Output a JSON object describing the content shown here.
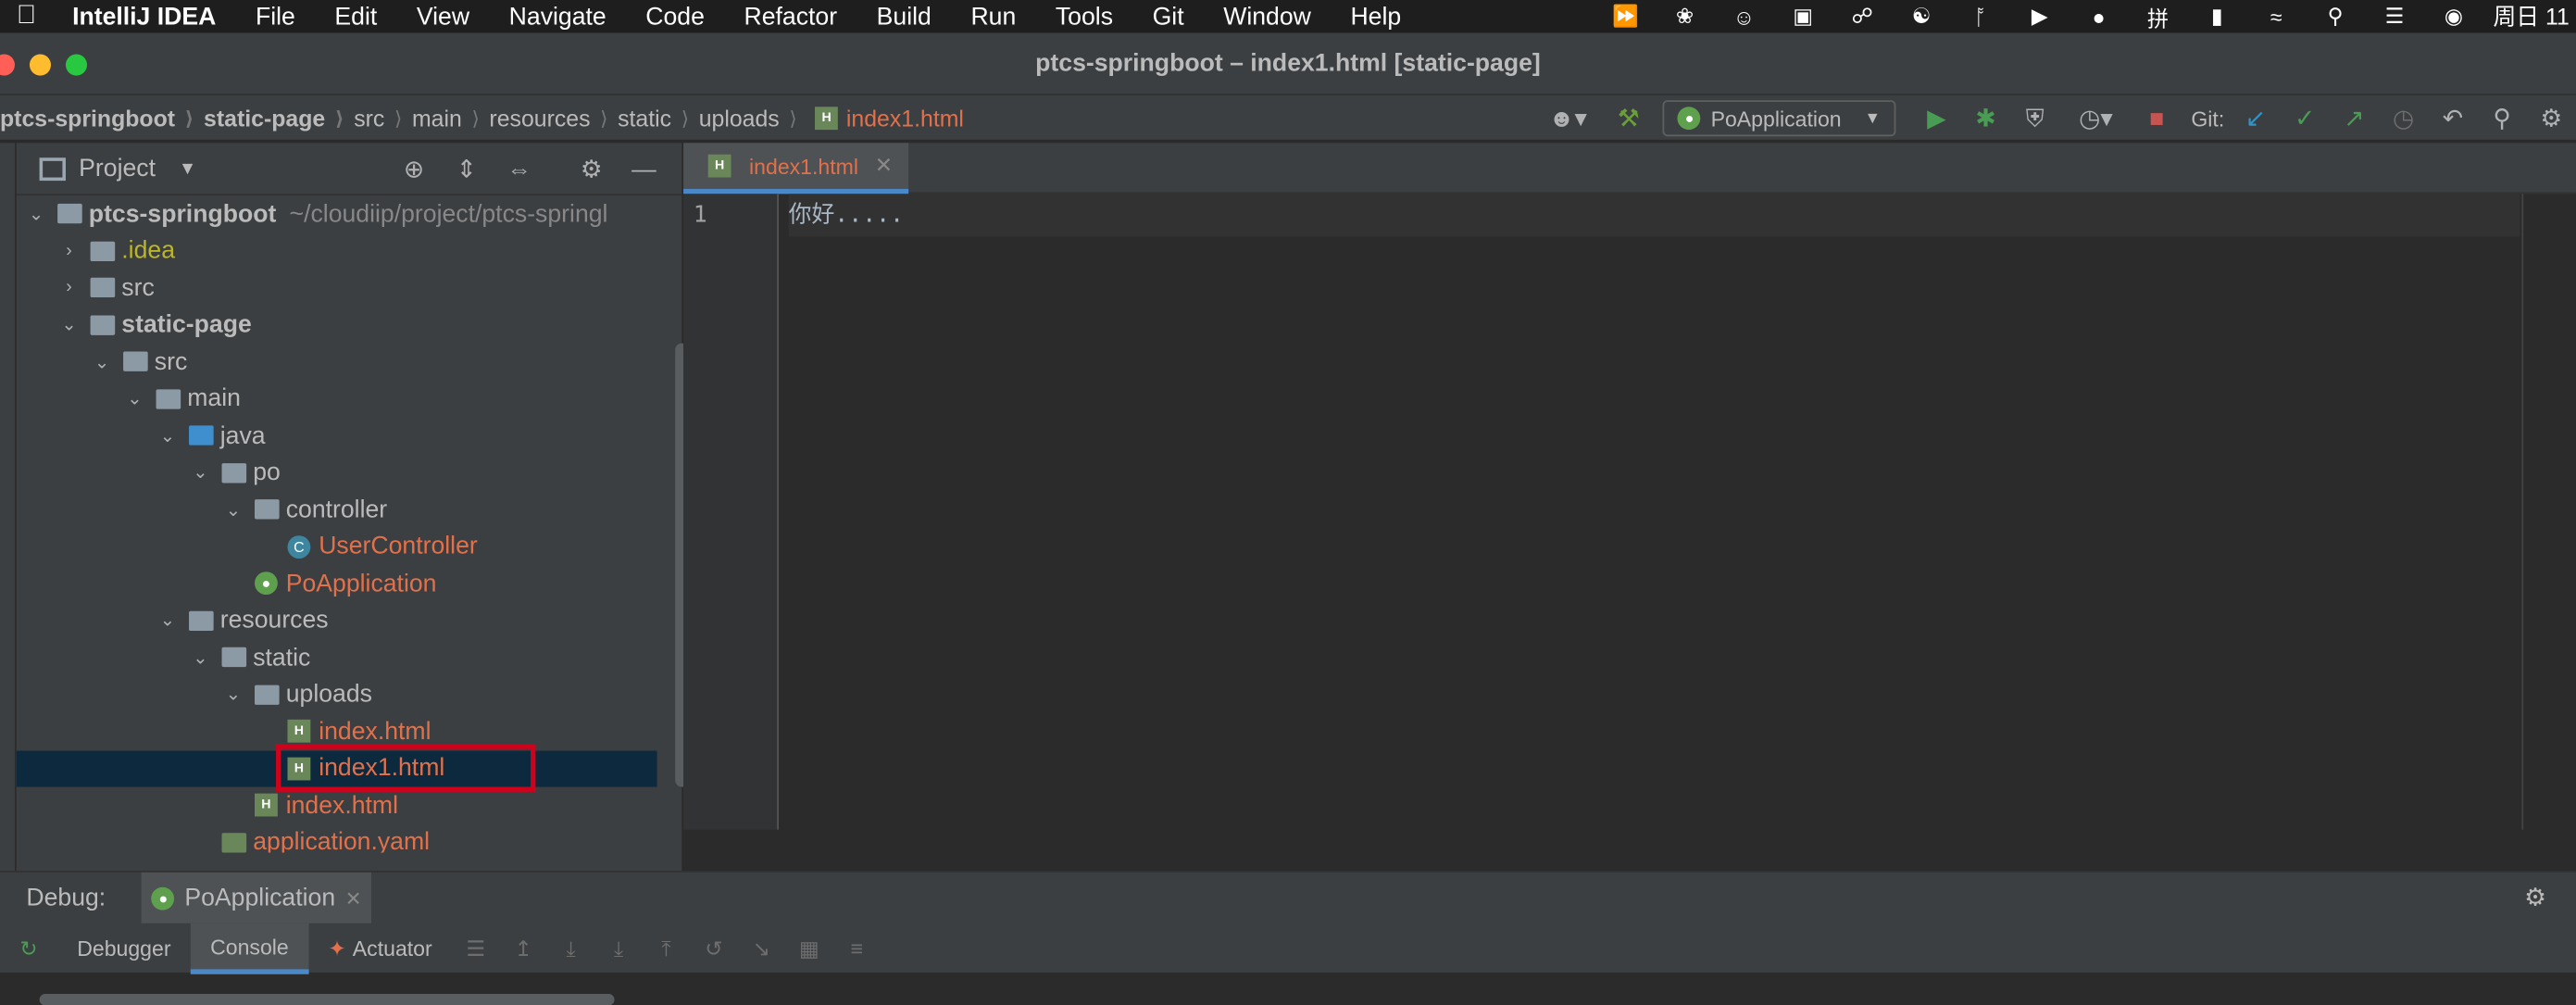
{
  "menubar": {
    "app": "IntelliJ IDEA",
    "items": [
      "File",
      "Edit",
      "View",
      "Navigate",
      "Code",
      "Refactor",
      "Build",
      "Run",
      "Tools",
      "Git",
      "Window",
      "Help"
    ],
    "clock": "周日 11"
  },
  "window": {
    "title": "ptcs-springboot – index1.html [static-page]"
  },
  "breadcrumb": [
    "ptcs-springboot",
    "static-page",
    "src",
    "main",
    "resources",
    "static",
    "uploads",
    "index1.html"
  ],
  "toolbar": {
    "run_config": "PoApplication",
    "git_label": "Git:"
  },
  "project": {
    "title": "Project",
    "tree": [
      {
        "label": "ptcs-springboot",
        "path": "~/cloudiip/project/ptcs-springl",
        "depth": 0,
        "open": true,
        "icon": "module-folder"
      },
      {
        "label": ".idea",
        "depth": 1,
        "open": false,
        "icon": "folder"
      },
      {
        "label": "src",
        "depth": 1,
        "open": false,
        "icon": "folder"
      },
      {
        "label": "static-page",
        "depth": 1,
        "open": true,
        "icon": "module-folder"
      },
      {
        "label": "src",
        "depth": 2,
        "open": true,
        "icon": "folder"
      },
      {
        "label": "main",
        "depth": 3,
        "open": true,
        "icon": "folder"
      },
      {
        "label": "java",
        "depth": 4,
        "open": true,
        "icon": "source-folder"
      },
      {
        "label": "po",
        "depth": 5,
        "open": true,
        "icon": "package"
      },
      {
        "label": "controller",
        "depth": 6,
        "open": true,
        "icon": "package"
      },
      {
        "label": "UserController",
        "depth": 7,
        "icon": "class"
      },
      {
        "label": "PoApplication",
        "depth": 6,
        "icon": "spring-boot"
      },
      {
        "label": "resources",
        "depth": 4,
        "open": true,
        "icon": "resources-folder"
      },
      {
        "label": "static",
        "depth": 5,
        "open": true,
        "icon": "folder"
      },
      {
        "label": "uploads",
        "depth": 6,
        "open": true,
        "icon": "folder"
      },
      {
        "label": "index.html",
        "depth": 7,
        "icon": "html"
      },
      {
        "label": "index1.html",
        "depth": 7,
        "icon": "html",
        "selected": true
      },
      {
        "label": "index.html",
        "depth": 6,
        "icon": "html"
      },
      {
        "label": "application.yaml",
        "depth": 5,
        "icon": "yaml"
      }
    ]
  },
  "editor": {
    "tab": "index1.html",
    "line_number": "1",
    "line_text": "你好....."
  },
  "debug": {
    "label": "Debug:",
    "session": "PoApplication",
    "tabs": [
      "Debugger",
      "Console",
      "Actuator"
    ],
    "active_tab": "Console"
  },
  "colors": {
    "accent": "#4a88c7",
    "modified_file": "#e2714b",
    "highlight_box": "#d0021b"
  }
}
